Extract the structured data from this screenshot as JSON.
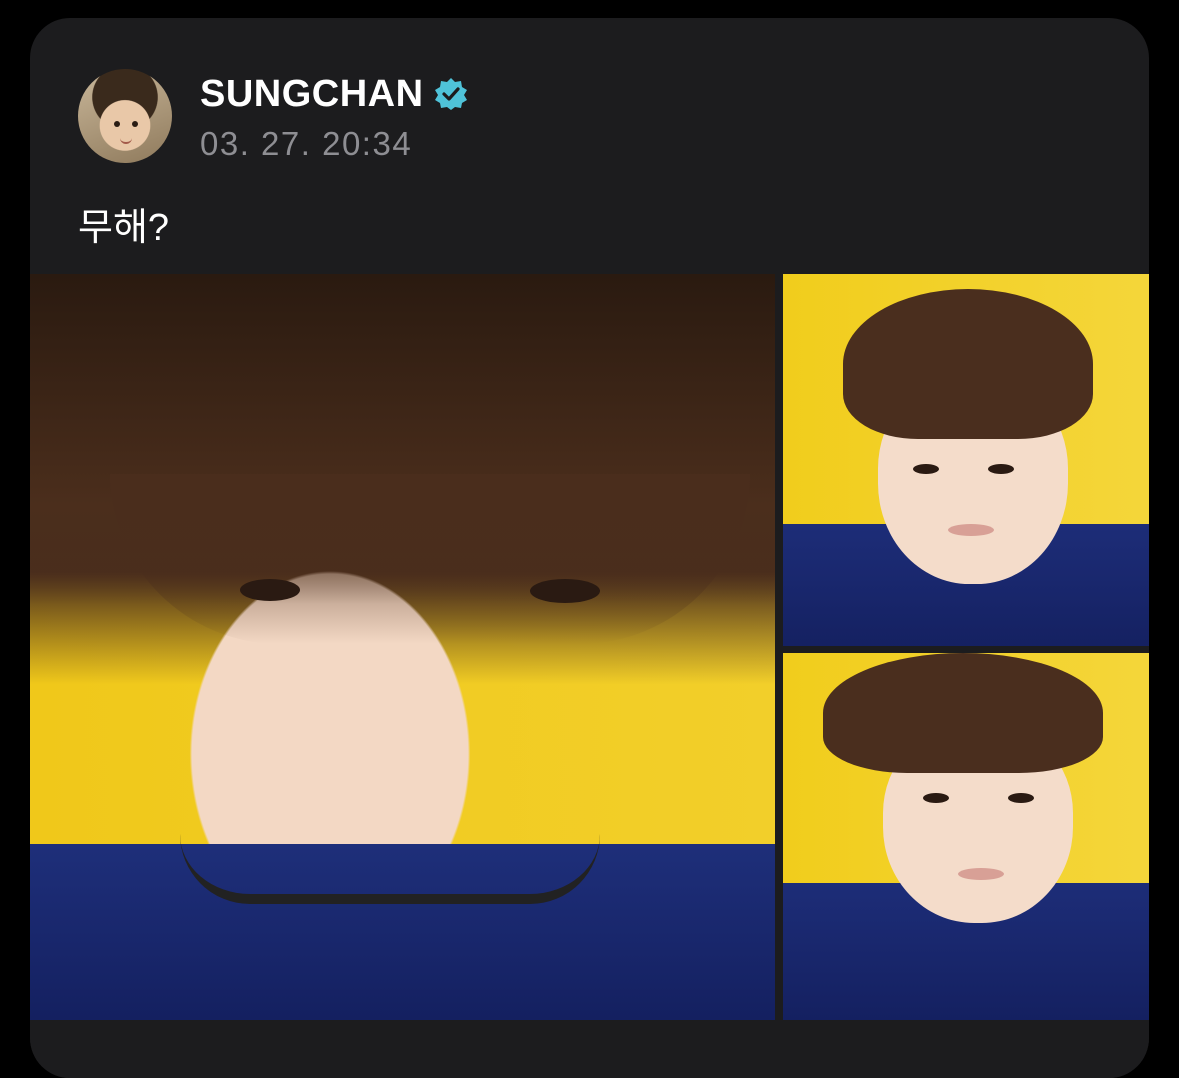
{
  "post": {
    "author": {
      "name": "SUNGCHAN",
      "verified": true,
      "verified_color": "#4fc3d9"
    },
    "timestamp": "03. 27. 20:34",
    "text": "무해?",
    "photos": [
      {
        "label": "photo-1"
      },
      {
        "label": "photo-2"
      },
      {
        "label": "photo-3"
      }
    ]
  },
  "colors": {
    "card_background": "#1c1c1e",
    "page_background": "#000000",
    "name_text": "#ffffff",
    "timestamp_text": "#8e8e93"
  },
  "icons": {
    "verified_badge": "verified-badge-icon"
  }
}
